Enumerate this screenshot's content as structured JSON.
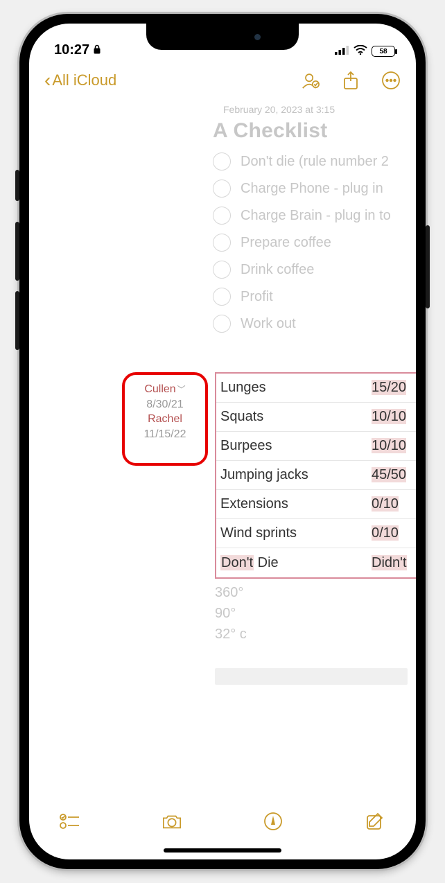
{
  "status": {
    "time": "10:27",
    "battery_pct": "58"
  },
  "nav": {
    "back_label": "All iCloud"
  },
  "note": {
    "timestamp": "February 20, 2023 at 3:15",
    "title": "A Checklist",
    "checklist": [
      "Don't die (rule number 2",
      "Charge Phone - plug in",
      "Charge Brain - plug in to",
      "Prepare coffee",
      "Drink coffee",
      "Profit",
      "Work out"
    ],
    "attribution": {
      "author1": "Cullen",
      "date1": "8/30/21",
      "author2": "Rachel",
      "date2": "11/15/22"
    },
    "table": [
      {
        "name": "Lunges",
        "reps": "15/20"
      },
      {
        "name": "Squats",
        "reps": "10/10"
      },
      {
        "name": "Burpees",
        "reps": "10/10"
      },
      {
        "name": "Jumping jacks",
        "reps": "45/50"
      },
      {
        "name": "Extensions",
        "reps": "0/10"
      },
      {
        "name": "Wind sprints",
        "reps": "0/10"
      },
      {
        "name_pre": "Don't",
        "name_post": " Die",
        "reps": "Didn't"
      }
    ],
    "extras": [
      "360°",
      "90°",
      "32° c"
    ]
  }
}
